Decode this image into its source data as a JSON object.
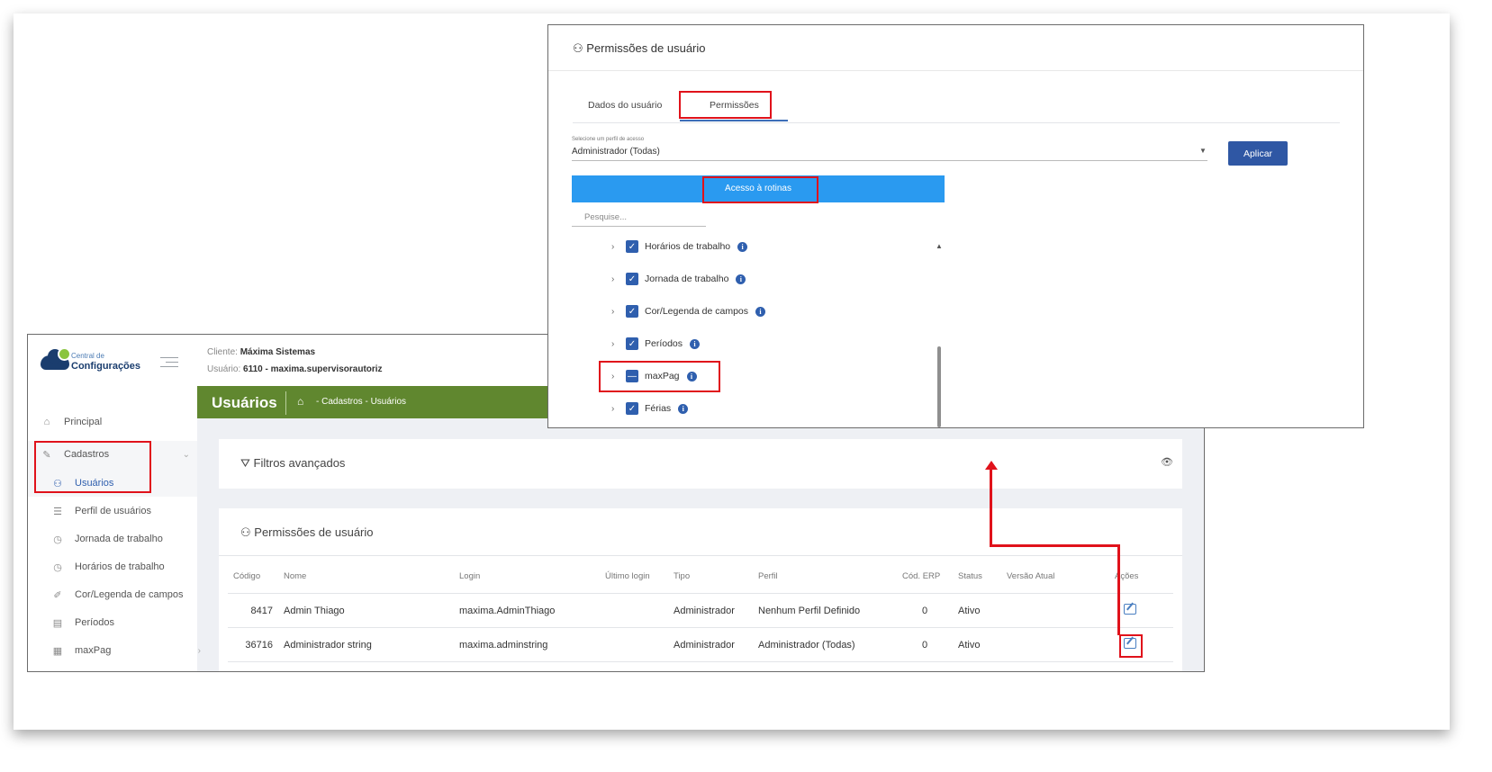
{
  "app": {
    "logo_small": "Central de",
    "logo_big": "Configurações",
    "client_label": "Cliente:",
    "client_value": "Máxima Sistemas",
    "user_label": "Usuário:",
    "user_value": "6110 - maxima.supervisorautoriz",
    "page_title": "Usuários",
    "breadcrumb": "- Cadastros - Usuários"
  },
  "sidebar": {
    "items": [
      {
        "label": "Principal",
        "icon": "home-icon"
      },
      {
        "label": "Cadastros",
        "icon": "edit-icon"
      },
      {
        "label": "Usuários",
        "icon": "users-icon"
      },
      {
        "label": "Perfil de usuários",
        "icon": "list-icon"
      },
      {
        "label": "Jornada de trabalho",
        "icon": "clock-icon"
      },
      {
        "label": "Horários de trabalho",
        "icon": "clock-icon"
      },
      {
        "label": "Cor/Legenda de campos",
        "icon": "pen-icon"
      },
      {
        "label": "Períodos",
        "icon": "calendar-icon"
      },
      {
        "label": "maxPag",
        "icon": "money-icon"
      }
    ]
  },
  "filters": {
    "title": "Filtros avançados"
  },
  "permissions_card": {
    "title": "Permissões de usuário"
  },
  "table": {
    "columns": [
      "Código",
      "Nome",
      "Login",
      "Último login",
      "Tipo",
      "Perfil",
      "Cód. ERP",
      "Status",
      "Versão Atual",
      "Ações"
    ],
    "rows": [
      [
        "8417",
        "Admin Thiago",
        "maxima.AdminThiago",
        "",
        "Administrador",
        "Nenhum Perfil Definido",
        "0",
        "Ativo",
        ""
      ],
      [
        "36716",
        "Administrador string",
        "maxima.adminstring",
        "",
        "Administrador",
        "Administrador (Todas)",
        "0",
        "Ativo",
        ""
      ]
    ]
  },
  "dialog": {
    "title": "Permissões de usuário",
    "tabs": [
      "Dados do usuário",
      "Permissões"
    ],
    "select_label": "Selecione um perfil de acesso",
    "select_value": "Administrador (Todas)",
    "apply_label": "Aplicar",
    "panel_title": "Acesso à rotinas",
    "search_placeholder": "Pesquise...",
    "tree": [
      {
        "label": "Horários de trabalho",
        "state": "checked"
      },
      {
        "label": "Jornada de trabalho",
        "state": "checked"
      },
      {
        "label": "Cor/Legenda de campos",
        "state": "checked"
      },
      {
        "label": "Períodos",
        "state": "checked"
      },
      {
        "label": "maxPag",
        "state": "indeterminate"
      },
      {
        "label": "Férias",
        "state": "checked"
      }
    ]
  },
  "colors": {
    "green_header": "#60872f",
    "panel_blue": "#2a9af0",
    "button_blue": "#2f57a4",
    "highlight_red": "#e0121b"
  }
}
